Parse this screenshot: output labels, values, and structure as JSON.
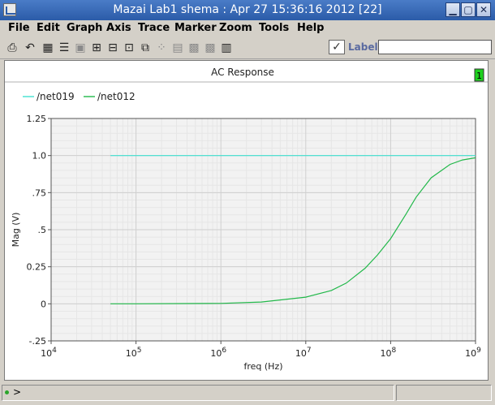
{
  "window": {
    "title": "Mazai Lab1 shema : Apr 27 15:36:16 2012 [22]",
    "minimize_glyph": "▁",
    "restore_glyph": "▢",
    "close_glyph": "✕"
  },
  "menu": [
    "File",
    "Edit",
    "Graph",
    "Axis",
    "Trace",
    "Marker",
    "Zoom",
    "Tools",
    "Help"
  ],
  "toolbar": {
    "icons": [
      "print-icon",
      "undo-icon",
      "grid-icon",
      "list-icon",
      "box-icon",
      "fit-icon",
      "axis-icon",
      "strip-icon",
      "zoom-in-icon",
      "dotted-grid-icon",
      "hatched-grid-icon",
      "hatched-grid-2-icon",
      "calculator-icon"
    ],
    "label_text": "Label",
    "label_value": ""
  },
  "subwindow_badge": "1",
  "status": {
    "prompt": ">"
  },
  "colors": {
    "net019": "#40e0d0",
    "net012": "#22b84a",
    "grid_major": "#cfcfcf",
    "grid_minor": "#e6e6e6",
    "plot_bg": "#f2f2f2"
  },
  "chart_data": {
    "type": "line",
    "title": "AC Response",
    "xlabel": "freq (Hz)",
    "ylabel": "Mag (V)",
    "x_scale": "log",
    "xlim": [
      10000,
      1000000000
    ],
    "ylim": [
      -0.25,
      1.25
    ],
    "y_ticks": [
      "-.25",
      "0",
      "0.25",
      ".5",
      ".75",
      "1.0",
      "1.25"
    ],
    "y_tick_values": [
      -0.25,
      0,
      0.25,
      0.5,
      0.75,
      1.0,
      1.25
    ],
    "x_ticks": [
      "10",
      "10",
      "10",
      "10",
      "10",
      "10"
    ],
    "x_tick_exponents": [
      "4",
      "5",
      "6",
      "7",
      "8",
      "9"
    ],
    "x_tick_values": [
      10000,
      100000,
      1000000,
      10000000,
      100000000,
      1000000000
    ],
    "grid": true,
    "legend": "top-left",
    "series": [
      {
        "name": "/net019",
        "color": "#40e0d0",
        "x": [
          50000,
          1000000000
        ],
        "y": [
          1.0,
          1.0
        ]
      },
      {
        "name": "/net012",
        "color": "#22b84a",
        "x": [
          50000,
          100000,
          1000000,
          3000000,
          10000000,
          20000000,
          30000000,
          50000000,
          70000000,
          100000000,
          150000000,
          200000000,
          300000000,
          500000000,
          700000000,
          1000000000
        ],
        "y": [
          0.0,
          0.0,
          0.003,
          0.012,
          0.045,
          0.09,
          0.14,
          0.24,
          0.33,
          0.44,
          0.6,
          0.72,
          0.85,
          0.94,
          0.97,
          0.985
        ]
      }
    ]
  }
}
